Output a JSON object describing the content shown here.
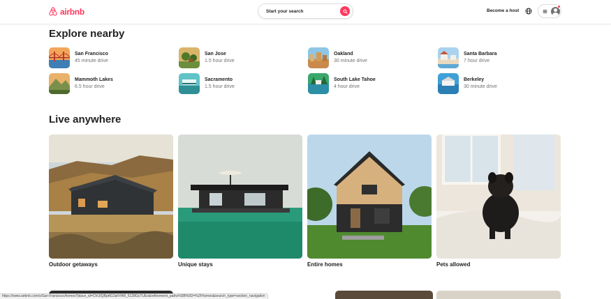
{
  "header": {
    "logo_text": "airbnb",
    "search_label": "Start your search",
    "host_link": "Become a host"
  },
  "nearby": {
    "title": "Explore nearby",
    "items": [
      {
        "name": "San Francisco",
        "sub": "45 minute drive"
      },
      {
        "name": "San Jose",
        "sub": "1.5 hour drive"
      },
      {
        "name": "Oakland",
        "sub": "30 minute drive"
      },
      {
        "name": "Santa Barbara",
        "sub": "7 hour drive"
      },
      {
        "name": "Mammoth Lakes",
        "sub": "6.5 hour drive"
      },
      {
        "name": "Sacramento",
        "sub": "1.5 hour drive"
      },
      {
        "name": "South Lake Tahoe",
        "sub": "4 hour drive"
      },
      {
        "name": "Berkeley",
        "sub": "30 minute drive"
      }
    ]
  },
  "live": {
    "title": "Live anywhere",
    "cards": [
      {
        "label": "Outdoor getaways"
      },
      {
        "label": "Unique stays"
      },
      {
        "label": "Entire homes"
      },
      {
        "label": "Pets allowed"
      }
    ]
  },
  "status_bar": {
    "url": "https://www.airbnb.com/s/San-Francisco/homes?place_id=ChIJIQBpAG2ahYAR_6128GcTUEo&refinement_paths%5B%5D=%2Fhomes&search_type=section_navigation"
  },
  "colors": {
    "brand": "#ff385c",
    "text": "#222222",
    "muted": "#717171"
  }
}
